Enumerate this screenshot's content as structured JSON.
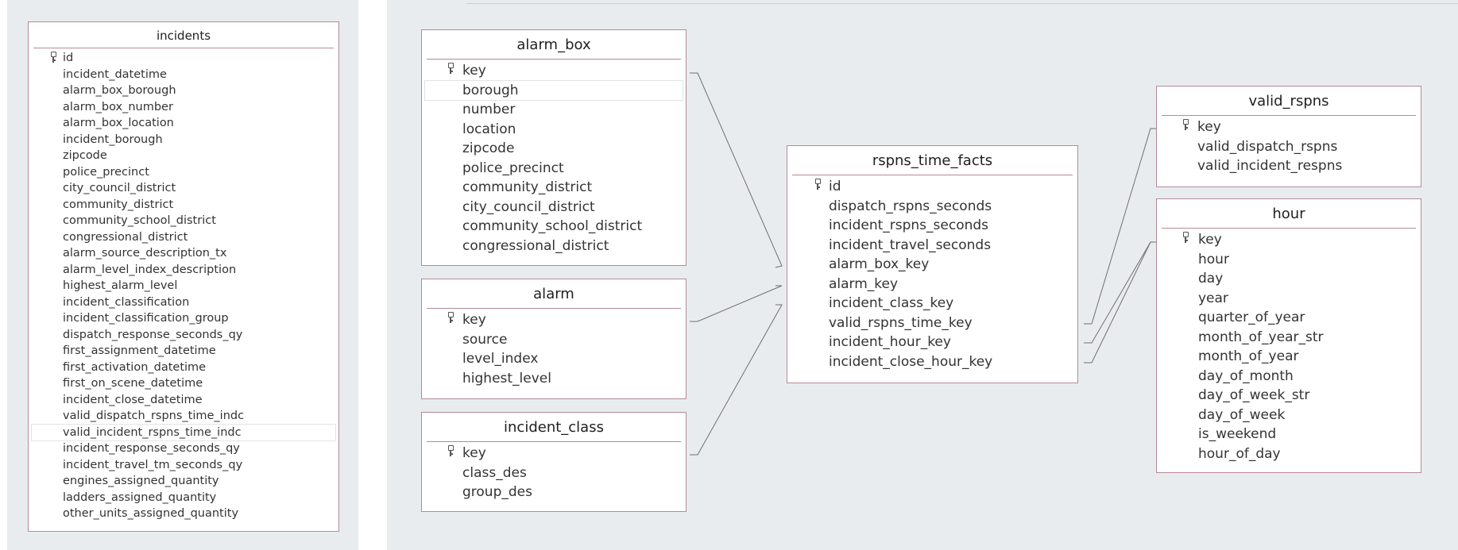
{
  "tables": {
    "incidents": {
      "title": "incidents",
      "fields": [
        "id",
        "incident_datetime",
        "alarm_box_borough",
        "alarm_box_number",
        "alarm_box_location",
        "incident_borough",
        "zipcode",
        "police_precinct",
        "city_council_district",
        "community_district",
        "community_school_district",
        "congressional_district",
        "alarm_source_description_tx",
        "alarm_level_index_description",
        "highest_alarm_level",
        "incident_classification",
        "incident_classification_group",
        "dispatch_response_seconds_qy",
        "first_assignment_datetime",
        "first_activation_datetime",
        "first_on_scene_datetime",
        "incident_close_datetime",
        "valid_dispatch_rspns_time_indc",
        "valid_incident_rspns_time_indc",
        "incident_response_seconds_qy",
        "incident_travel_tm_seconds_qy",
        "engines_assigned_quantity",
        "ladders_assigned_quantity",
        "other_units_assigned_quantity"
      ],
      "key_field": "id"
    },
    "alarm_box": {
      "title": "alarm_box",
      "fields": [
        "key",
        "borough",
        "number",
        "location",
        "zipcode",
        "police_precinct",
        "community_district",
        "city_council_district",
        "community_school_district",
        "congressional_district"
      ],
      "key_field": "key"
    },
    "alarm": {
      "title": "alarm",
      "fields": [
        "key",
        "source",
        "level_index",
        "highest_level"
      ],
      "key_field": "key"
    },
    "incident_class": {
      "title": "incident_class",
      "fields": [
        "key",
        "class_des",
        "group_des"
      ],
      "key_field": "key"
    },
    "rspns_time_facts": {
      "title": "rspns_time_facts",
      "fields": [
        "id",
        "dispatch_rspns_seconds",
        "incident_rspns_seconds",
        "incident_travel_seconds",
        "alarm_box_key",
        "alarm_key",
        "incident_class_key",
        "valid_rspns_time_key",
        "incident_hour_key",
        "incident_close_hour_key"
      ],
      "key_field": "id"
    },
    "valid_rspns": {
      "title": "valid_rspns",
      "fields": [
        "key",
        "valid_dispatch_rspns",
        "valid_incident_respns"
      ],
      "key_field": "key"
    },
    "hour": {
      "title": "hour",
      "fields": [
        "key",
        "hour",
        "day",
        "year",
        "quarter_of_year",
        "month_of_year_str",
        "month_of_year",
        "day_of_month",
        "day_of_week_str",
        "day_of_week",
        "is_weekend",
        "hour_of_day"
      ],
      "key_field": "key"
    }
  },
  "relationships": [
    {
      "from": "rspns_time_facts.alarm_box_key",
      "to": "alarm_box.key"
    },
    {
      "from": "rspns_time_facts.alarm_key",
      "to": "alarm.key"
    },
    {
      "from": "rspns_time_facts.incident_class_key",
      "to": "incident_class.key"
    },
    {
      "from": "rspns_time_facts.valid_rspns_time_key",
      "to": "valid_rspns.key"
    },
    {
      "from": "rspns_time_facts.incident_hour_key",
      "to": "hour.key"
    },
    {
      "from": "rspns_time_facts.incident_close_hour_key",
      "to": "hour.key"
    }
  ],
  "colors": {
    "canvas": "#e9ecef",
    "entity_border": "#b58a96",
    "wire": "#6f6f6f"
  }
}
